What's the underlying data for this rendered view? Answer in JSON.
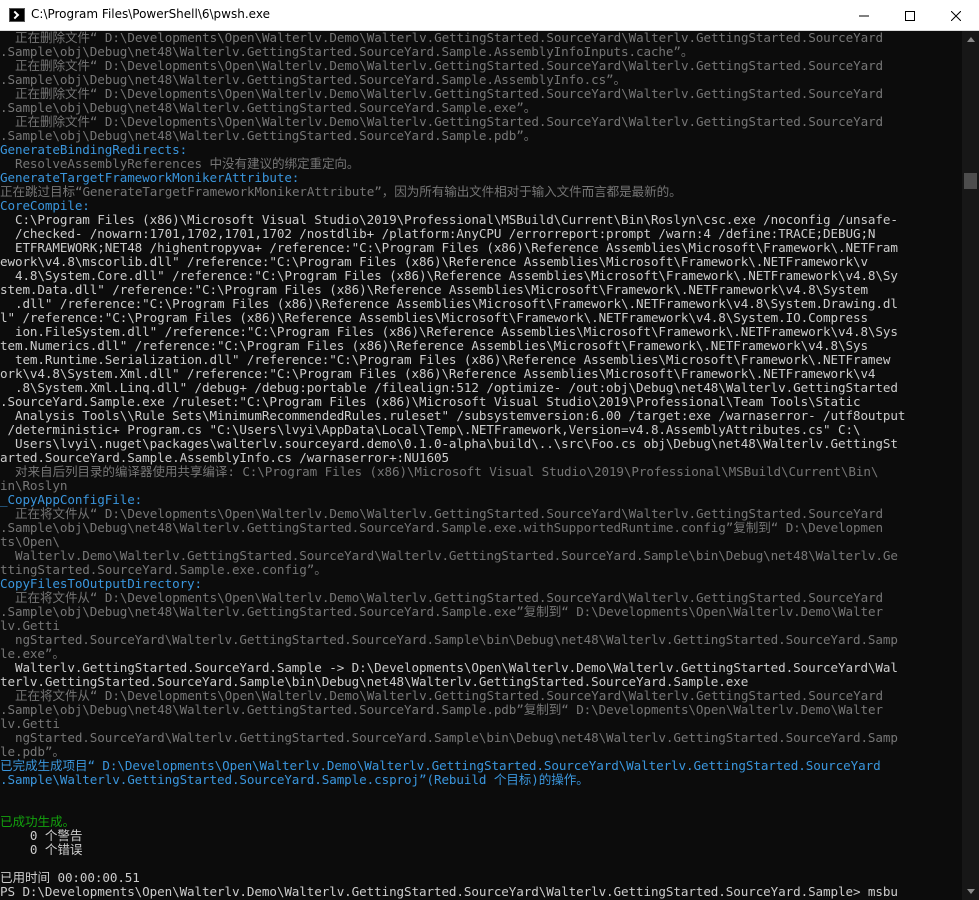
{
  "window": {
    "title": "C:\\Program Files\\PowerShell\\6\\pwsh.exe",
    "icon": "powershell-icon",
    "buttons": [
      "minimize-icon",
      "maximize-icon",
      "close-icon"
    ]
  },
  "colors": {
    "background": "#0c0c0c",
    "gray": "#767676",
    "target": "#3a96dd",
    "white": "#cccccc",
    "green": "#13a10e"
  },
  "console": {
    "lines": [
      {
        "t": "  正在删除文件“ D:\\Developments\\Open\\Walterlv.Demo\\Walterlv.GettingStarted.SourceYard\\Walterlv.GettingStarted.SourceYard",
        "c": "gray"
      },
      {
        "t": ".Sample\\obj\\Debug\\net48\\Walterlv.GettingStarted.SourceYard.Sample.AssemblyInfoInputs.cache”。",
        "c": "gray"
      },
      {
        "t": "  正在删除文件“ D:\\Developments\\Open\\Walterlv.Demo\\Walterlv.GettingStarted.SourceYard\\Walterlv.GettingStarted.SourceYard",
        "c": "gray"
      },
      {
        "t": ".Sample\\obj\\Debug\\net48\\Walterlv.GettingStarted.SourceYard.Sample.AssemblyInfo.cs”。",
        "c": "gray"
      },
      {
        "t": "  正在删除文件“ D:\\Developments\\Open\\Walterlv.Demo\\Walterlv.GettingStarted.SourceYard\\Walterlv.GettingStarted.SourceYard",
        "c": "gray"
      },
      {
        "t": ".Sample\\obj\\Debug\\net48\\Walterlv.GettingStarted.SourceYard.Sample.exe”。",
        "c": "gray"
      },
      {
        "t": "  正在删除文件“ D:\\Developments\\Open\\Walterlv.Demo\\Walterlv.GettingStarted.SourceYard\\Walterlv.GettingStarted.SourceYard",
        "c": "gray"
      },
      {
        "t": ".Sample\\obj\\Debug\\net48\\Walterlv.GettingStarted.SourceYard.Sample.pdb”。",
        "c": "gray"
      },
      {
        "t": "GenerateBindingRedirects:",
        "c": "target"
      },
      {
        "t": "  ResolveAssemblyReferences 中没有建议的绑定重定向。",
        "c": "gray"
      },
      {
        "t": "GenerateTargetFrameworkMonikerAttribute:",
        "c": "target"
      },
      {
        "t": "正在跳过目标“GenerateTargetFrameworkMonikerAttribute”，因为所有输出文件相对于输入文件而言都是最新的。",
        "c": "gray"
      },
      {
        "t": "CoreCompile:",
        "c": "target"
      },
      {
        "t": "  C:\\Program Files (x86)\\Microsoft Visual Studio\\2019\\Professional\\MSBuild\\Current\\Bin\\Roslyn\\csc.exe /noconfig /unsafe-",
        "c": "white"
      },
      {
        "t": "  /checked- /nowarn:1701,1702,1701,1702 /nostdlib+ /platform:AnyCPU /errorreport:prompt /warn:4 /define:TRACE;DEBUG;N",
        "c": "white"
      },
      {
        "t": "  ETFRAMEWORK;NET48 /highentropyva+ /reference:\"C:\\Program Files (x86)\\Reference Assemblies\\Microsoft\\Framework\\.NETFram",
        "c": "white"
      },
      {
        "t": "ework\\v4.8\\mscorlib.dll\" /reference:\"C:\\Program Files (x86)\\Reference Assemblies\\Microsoft\\Framework\\.NETFramework\\v",
        "c": "white"
      },
      {
        "t": "  4.8\\System.Core.dll\" /reference:\"C:\\Program Files (x86)\\Reference Assemblies\\Microsoft\\Framework\\.NETFramework\\v4.8\\Sy",
        "c": "white"
      },
      {
        "t": "stem.Data.dll\" /reference:\"C:\\Program Files (x86)\\Reference Assemblies\\Microsoft\\Framework\\.NETFramework\\v4.8\\System",
        "c": "white"
      },
      {
        "t": "  .dll\" /reference:\"C:\\Program Files (x86)\\Reference Assemblies\\Microsoft\\Framework\\.NETFramework\\v4.8\\System.Drawing.dl",
        "c": "white"
      },
      {
        "t": "l\" /reference:\"C:\\Program Files (x86)\\Reference Assemblies\\Microsoft\\Framework\\.NETFramework\\v4.8\\System.IO.Compress",
        "c": "white"
      },
      {
        "t": "  ion.FileSystem.dll\" /reference:\"C:\\Program Files (x86)\\Reference Assemblies\\Microsoft\\Framework\\.NETFramework\\v4.8\\Sys",
        "c": "white"
      },
      {
        "t": "tem.Numerics.dll\" /reference:\"C:\\Program Files (x86)\\Reference Assemblies\\Microsoft\\Framework\\.NETFramework\\v4.8\\Sys",
        "c": "white"
      },
      {
        "t": "  tem.Runtime.Serialization.dll\" /reference:\"C:\\Program Files (x86)\\Reference Assemblies\\Microsoft\\Framework\\.NETFramew",
        "c": "white"
      },
      {
        "t": "ork\\v4.8\\System.Xml.dll\" /reference:\"C:\\Program Files (x86)\\Reference Assemblies\\Microsoft\\Framework\\.NETFramework\\v4",
        "c": "white"
      },
      {
        "t": "  .8\\System.Xml.Linq.dll\" /debug+ /debug:portable /filealign:512 /optimize- /out:obj\\Debug\\net48\\Walterlv.GettingStarted",
        "c": "white"
      },
      {
        "t": ".SourceYard.Sample.exe /ruleset:\"C:\\Program Files (x86)\\Microsoft Visual Studio\\2019\\Professional\\Team Tools\\Static",
        "c": "white"
      },
      {
        "t": "  Analysis Tools\\\\Rule Sets\\MinimumRecommendedRules.ruleset\" /subsystemversion:6.00 /target:exe /warnaserror- /utf8output",
        "c": "white"
      },
      {
        "t": " /deterministic+ Program.cs \"C:\\Users\\lvyi\\AppData\\Local\\Temp\\.NETFramework,Version=v4.8.AssemblyAttributes.cs\" C:\\",
        "c": "white"
      },
      {
        "t": "  Users\\lvyi\\.nuget\\packages\\walterlv.sourceyard.demo\\0.1.0-alpha\\build\\..\\src\\Foo.cs obj\\Debug\\net48\\Walterlv.GettingSt",
        "c": "white"
      },
      {
        "t": "arted.SourceYard.Sample.AssemblyInfo.cs /warnaserror+:NU1605",
        "c": "white"
      },
      {
        "t": "  对来自后列目录的编译器使用共享编译: C:\\Program Files (x86)\\Microsoft Visual Studio\\2019\\Professional\\MSBuild\\Current\\Bin\\",
        "c": "gray"
      },
      {
        "t": "in\\Roslyn",
        "c": "gray"
      },
      {
        "t": "_CopyAppConfigFile:",
        "c": "target"
      },
      {
        "t": "  正在将文件从“ D:\\Developments\\Open\\Walterlv.Demo\\Walterlv.GettingStarted.SourceYard\\Walterlv.GettingStarted.SourceYard",
        "c": "gray"
      },
      {
        "t": ".Sample\\obj\\Debug\\net48\\Walterlv.GettingStarted.SourceYard.Sample.exe.withSupportedRuntime.config”复制到“ D:\\Developmen",
        "c": "gray"
      },
      {
        "t": "ts\\Open\\",
        "c": "gray"
      },
      {
        "t": "  Walterlv.Demo\\Walterlv.GettingStarted.SourceYard\\Walterlv.GettingStarted.SourceYard.Sample\\bin\\Debug\\net48\\Walterlv.Ge",
        "c": "gray"
      },
      {
        "t": "ttingStarted.SourceYard.Sample.exe.config”。",
        "c": "gray"
      },
      {
        "t": "CopyFilesToOutputDirectory:",
        "c": "target"
      },
      {
        "t": "  正在将文件从“ D:\\Developments\\Open\\Walterlv.Demo\\Walterlv.GettingStarted.SourceYard\\Walterlv.GettingStarted.SourceYard",
        "c": "gray"
      },
      {
        "t": ".Sample\\obj\\Debug\\net48\\Walterlv.GettingStarted.SourceYard.Sample.exe”复制到“ D:\\Developments\\Open\\Walterlv.Demo\\Walter",
        "c": "gray"
      },
      {
        "t": "lv.Getti",
        "c": "gray"
      },
      {
        "t": "  ngStarted.SourceYard\\Walterlv.GettingStarted.SourceYard.Sample\\bin\\Debug\\net48\\Walterlv.GettingStarted.SourceYard.Samp",
        "c": "gray"
      },
      {
        "t": "le.exe”。",
        "c": "gray"
      },
      {
        "t": "  Walterlv.GettingStarted.SourceYard.Sample -> D:\\Developments\\Open\\Walterlv.Demo\\Walterlv.GettingStarted.SourceYard\\Wal",
        "c": "white"
      },
      {
        "t": "terlv.GettingStarted.SourceYard.Sample\\bin\\Debug\\net48\\Walterlv.GettingStarted.SourceYard.Sample.exe",
        "c": "white"
      },
      {
        "t": "  正在将文件从“ D:\\Developments\\Open\\Walterlv.Demo\\Walterlv.GettingStarted.SourceYard\\Walterlv.GettingStarted.SourceYard",
        "c": "gray"
      },
      {
        "t": ".Sample\\obj\\Debug\\net48\\Walterlv.GettingStarted.SourceYard.Sample.pdb”复制到“ D:\\Developments\\Open\\Walterlv.Demo\\Walter",
        "c": "gray"
      },
      {
        "t": "lv.Getti",
        "c": "gray"
      },
      {
        "t": "  ngStarted.SourceYard\\Walterlv.GettingStarted.SourceYard.Sample\\bin\\Debug\\net48\\Walterlv.GettingStarted.SourceYard.Samp",
        "c": "gray"
      },
      {
        "t": "le.pdb”。",
        "c": "gray"
      },
      {
        "t": "已完成生成项目“ D:\\Developments\\Open\\Walterlv.Demo\\Walterlv.GettingStarted.SourceYard\\Walterlv.GettingStarted.SourceYard",
        "c": "target"
      },
      {
        "t": ".Sample\\Walterlv.GettingStarted.SourceYard.Sample.csproj”(Rebuild 个目标)的操作。",
        "c": "target"
      },
      {
        "t": "",
        "c": "white"
      },
      {
        "t": "",
        "c": "white"
      },
      {
        "t": "已成功生成。",
        "c": "green"
      },
      {
        "t": "    0 个警告",
        "c": "white"
      },
      {
        "t": "    0 个错误",
        "c": "white"
      },
      {
        "t": "",
        "c": "white"
      },
      {
        "t": "已用时间 00:00:00.51",
        "c": "white"
      },
      {
        "t": "PS D:\\Developments\\Open\\Walterlv.Demo\\Walterlv.GettingStarted.SourceYard\\Walterlv.GettingStarted.SourceYard.Sample> msbu",
        "c": "white"
      }
    ]
  }
}
